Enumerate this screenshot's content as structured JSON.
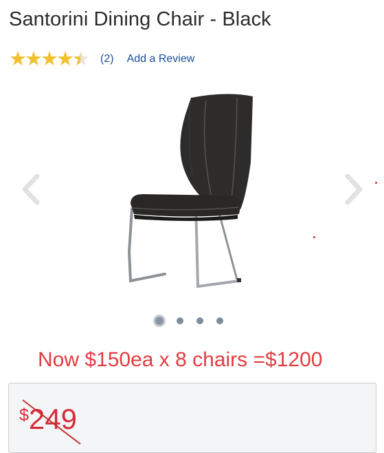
{
  "product": {
    "title": "Santorini Dining Chair - Black"
  },
  "rating": {
    "value": 4.5,
    "max": 5,
    "review_count": "(2)",
    "add_review_label": "Add a Review"
  },
  "carousel": {
    "slide_count": 4,
    "active_slide": 1
  },
  "annotation": {
    "text": "Now $150ea x 8 chairs =$1200",
    "color": "#e23b3f"
  },
  "price": {
    "currency_symbol": "$",
    "amount": "249",
    "color": "#d62c3a"
  },
  "colors": {
    "star": "#f2c12e",
    "link": "#1a4f9c"
  }
}
